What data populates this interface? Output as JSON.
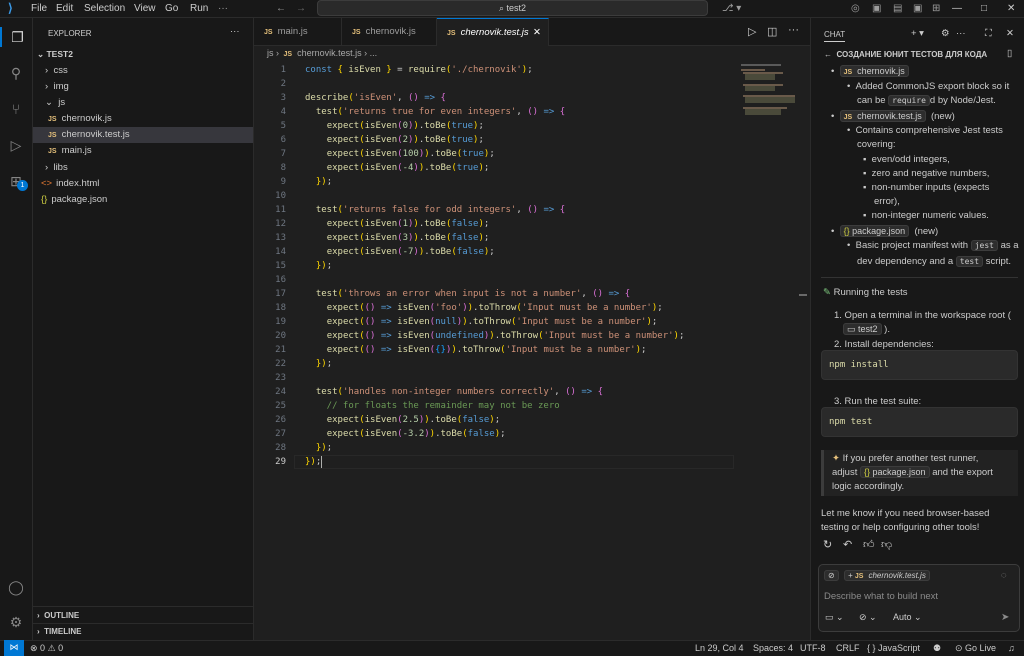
{
  "menu": {
    "file": "File",
    "edit": "Edit",
    "selection": "Selection",
    "view": "View",
    "go": "Go",
    "run": "Run"
  },
  "search": {
    "text": "test2"
  },
  "explorer": {
    "title": "EXPLORER",
    "root": "TEST2",
    "items": [
      "css",
      "img",
      "js",
      "chernovik.js",
      "chernovik.test.js",
      "main.js",
      "libs",
      "index.html",
      "package.json"
    ],
    "outline": "OUTLINE",
    "timeline": "TIMELINE"
  },
  "badge": "1",
  "tabs": [
    "main.js",
    "chernovik.js",
    "chernovik.test.js"
  ],
  "breadcrumb": {
    "folder": "js",
    "file": "chernovik.test.js",
    "more": "..."
  },
  "code": [
    "const { isEven } = require('./chernovik');",
    "",
    "describe('isEven', () => {",
    "  test('returns true for even integers', () => {",
    "    expect(isEven(0)).toBe(true);",
    "    expect(isEven(2)).toBe(true);",
    "    expect(isEven(100)).toBe(true);",
    "    expect(isEven(-4)).toBe(true);",
    "  });",
    "",
    "  test('returns false for odd integers', () => {",
    "    expect(isEven(1)).toBe(false);",
    "    expect(isEven(3)).toBe(false);",
    "    expect(isEven(-7)).toBe(false);",
    "  });",
    "",
    "  test('throws an error when input is not a number', () => {",
    "    expect(() => isEven('foo')).toThrow('Input must be a number');",
    "    expect(() => isEven(null)).toThrow('Input must be a number');",
    "    expect(() => isEven(undefined)).toThrow('Input must be a number');",
    "    expect(() => isEven({})).toThrow('Input must be a number');",
    "  });",
    "",
    "  test('handles non-integer numbers correctly', () => {",
    "    // for floats the remainder may not be zero",
    "    expect(isEven(2.5)).toBe(false);",
    "    expect(isEven(-3.2)).toBe(false);",
    "  });",
    "});"
  ],
  "chat": {
    "tab": "CHAT",
    "title": "СОЗДАНИЕ ЮНИТ ТЕСТОВ ДЛЯ КОДА",
    "f1": "chernovik.js",
    "f1a": "Added CommonJS export block so it",
    "f1b_pre": "can be",
    "f1b_chip": "require",
    "f1b_post": "d by Node/Jest.",
    "f2": "chernovik.test.js",
    "f2new": "(new)",
    "f2a": "Contains comprehensive Jest tests",
    "f2b": "covering:",
    "s1": "even/odd integers,",
    "s2": "zero and negative numbers,",
    "s3": "non-number inputs (expects",
    "s3b": "error),",
    "s4": "non-integer numeric values.",
    "f3": "package.json",
    "f3new": "(new)",
    "f3a_pre": "Basic project manifest with",
    "f3a_chip": "jest",
    "f3a_post": "as a",
    "f3b_pre": "dev dependency and a",
    "f3b_chip": "test",
    "f3b_post": "script.",
    "running": "Running the tests",
    "r1": "1. Open a terminal in the workspace root (",
    "r1b": "test2",
    "r1c": ").",
    "r2": "2. Install dependencies:",
    "cmd1": "npm install",
    "r3": "3. Run the test suite:",
    "cmd2": "npm test",
    "tip1": "If you prefer another test runner,",
    "tip2_pre": "adjust",
    "tip2_file": "package.json",
    "tip2_post": "and the export",
    "tip3": "logic accordingly.",
    "closing1": "Let me know if you need browser-based",
    "closing2": "testing or help configuring other tools!",
    "ctx_file": "chernovik.test.js",
    "placeholder": "Describe what to build next",
    "mode": "Auto"
  },
  "status": {
    "errors": "0",
    "warnings": "0",
    "pos": "Ln 29, Col 4",
    "spaces": "Spaces: 4",
    "enc": "UTF-8",
    "eol": "CRLF",
    "lang": "JavaScript",
    "live": "Go Live"
  }
}
